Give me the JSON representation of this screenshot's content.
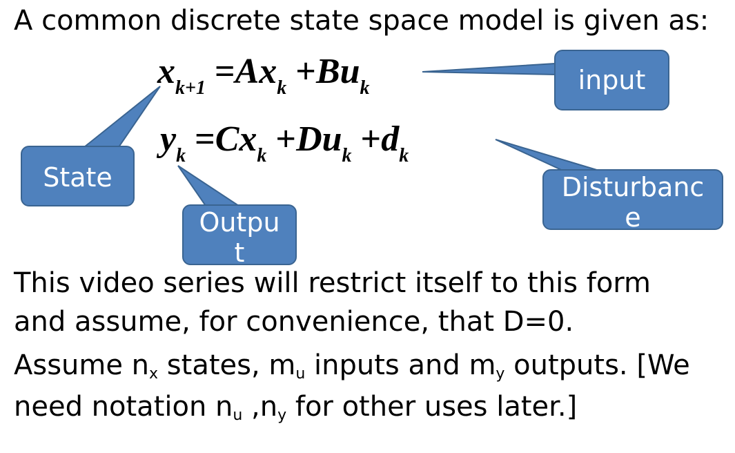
{
  "intro": "A common discrete state space model is given as:",
  "equation1": {
    "lhs_var": "x",
    "lhs_sub": "k+1",
    "eq": "=",
    "t1_coef": "A",
    "t1_var": "x",
    "t1_sub": "k",
    "plus": "+",
    "t2_coef": "B",
    "t2_var": "u",
    "t2_sub": "k"
  },
  "equation2": {
    "lhs_var": "y",
    "lhs_sub": "k",
    "eq": "=",
    "t1_coef": "C",
    "t1_var": "x",
    "t1_sub": "k",
    "plus1": "+",
    "t2_coef": "D",
    "t2_var": "u",
    "t2_sub": "k",
    "plus2": "+",
    "t3_var": "d",
    "t3_sub": "k"
  },
  "callouts": {
    "input": "input",
    "state": "State",
    "output": "Output",
    "disturbance": "Disturbance"
  },
  "body": {
    "line1": "This video series will restrict itself to this form",
    "line2": "and assume, for convenience, that D=0.",
    "line3_a": "Assume n",
    "line3_sub1": "x",
    "line3_b": " states, m",
    "line3_sub2": "u",
    "line3_c": " inputs and m",
    "line3_sub3": "y",
    "line3_d": " outputs. [We",
    "line4_a": "need notation n",
    "line4_sub1": "u",
    "line4_b": " ,n",
    "line4_sub2": "y",
    "line4_c": " for other uses later.]"
  },
  "colors": {
    "callout_fill": "#4f81bd",
    "callout_border": "#3a6491",
    "text": "#000000"
  }
}
